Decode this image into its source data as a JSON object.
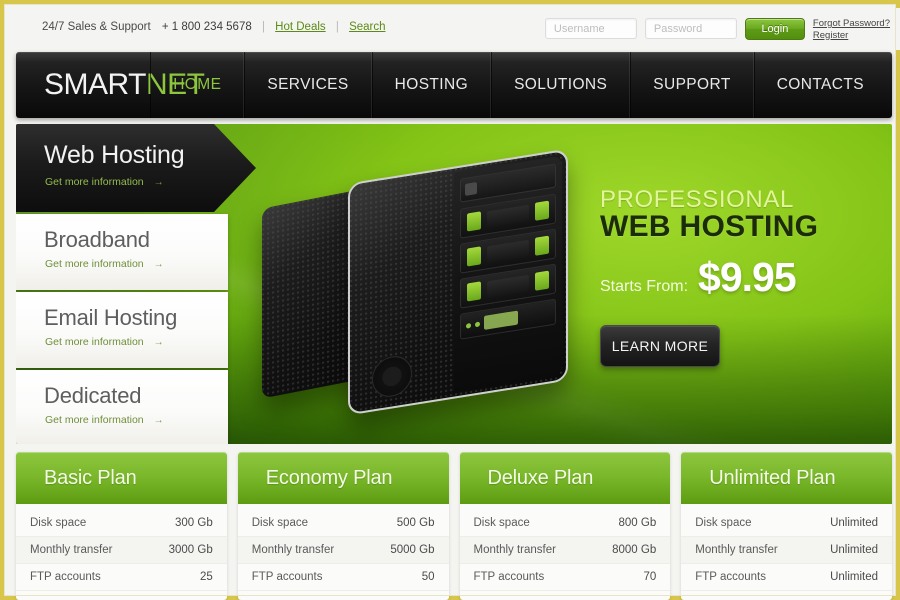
{
  "topbar": {
    "support_text": "24/7 Sales & Support",
    "phone": "+ 1 800 234 5678",
    "hot_deals": "Hot Deals",
    "search": "Search",
    "username_placeholder": "Username",
    "password_placeholder": "Password",
    "login_label": "Login",
    "forgot_password": "Forgot Password?",
    "register": "Register"
  },
  "brand": {
    "first": "SMART",
    "second": "NET"
  },
  "nav": {
    "items": [
      {
        "label": "HOME",
        "active": true
      },
      {
        "label": "SERVICES",
        "active": false
      },
      {
        "label": "HOSTING",
        "active": false
      },
      {
        "label": "SOLUTIONS",
        "active": false
      },
      {
        "label": "SUPPORT",
        "active": false
      },
      {
        "label": "CONTACTS",
        "active": false
      }
    ]
  },
  "hero": {
    "tabs": [
      {
        "title": "Web Hosting",
        "sub": "Get more information",
        "arrow": "→",
        "active": true
      },
      {
        "title": "Broadband",
        "sub": "Get more information",
        "arrow": "→",
        "active": false
      },
      {
        "title": "Email Hosting",
        "sub": "Get more information",
        "arrow": "→",
        "active": false
      },
      {
        "title": "Dedicated",
        "sub": "Get more information",
        "arrow": "→",
        "active": false
      }
    ],
    "headline_top": "PROFESSIONAL",
    "headline_main": "WEB HOSTING",
    "starts_from": "Starts From:",
    "price": "$9.95",
    "cta": "LEARN MORE"
  },
  "plans": [
    {
      "name": "Basic Plan",
      "rows": [
        {
          "label": "Disk space",
          "value": "300 Gb"
        },
        {
          "label": "Monthly transfer",
          "value": "3000 Gb"
        },
        {
          "label": "FTP accounts",
          "value": "25"
        }
      ]
    },
    {
      "name": "Economy Plan",
      "rows": [
        {
          "label": "Disk space",
          "value": "500 Gb"
        },
        {
          "label": "Monthly transfer",
          "value": "5000 Gb"
        },
        {
          "label": "FTP accounts",
          "value": "50"
        }
      ]
    },
    {
      "name": "Deluxe Plan",
      "rows": [
        {
          "label": "Disk space",
          "value": "800 Gb"
        },
        {
          "label": "Monthly transfer",
          "value": "8000 Gb"
        },
        {
          "label": "FTP accounts",
          "value": "70"
        }
      ]
    },
    {
      "name": "Unlimited Plan",
      "rows": [
        {
          "label": "Disk space",
          "value": "Unlimited"
        },
        {
          "label": "Monthly transfer",
          "value": "Unlimited"
        },
        {
          "label": "FTP accounts",
          "value": "Unlimited"
        }
      ]
    }
  ],
  "colors": {
    "brand_green": "#8cc63f",
    "hero_green": "#84c417",
    "frame_gold": "#d8c64a",
    "nav_dark": "#151515"
  }
}
